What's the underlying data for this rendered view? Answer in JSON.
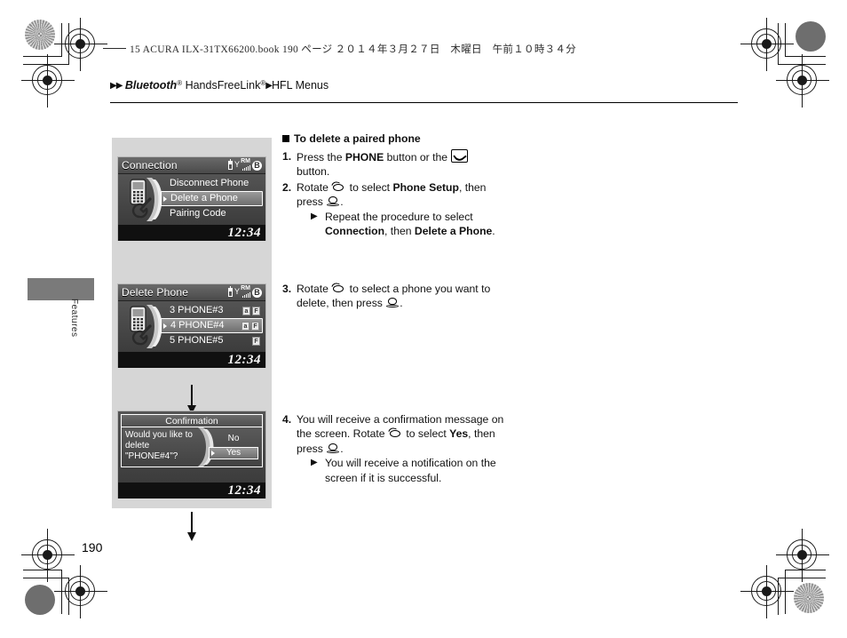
{
  "print_header": "15 ACURA ILX-31TX66200.book   190 ページ   ２０１４年３月２７日　木曜日　午前１０時３４分",
  "breadcrumb": {
    "arrow1": "▶▶",
    "bluetooth": "Bluetooth",
    "reg1": "®",
    "handsfree": " HandsFreeLink",
    "reg2": "®",
    "arrow2": "▶",
    "last": "HFL Menus"
  },
  "side_tab": {
    "label": "Features"
  },
  "page_number": "190",
  "screens": [
    {
      "title": "Connection",
      "clock": "12:34",
      "status": {
        "roaming": "RM",
        "bluetooth": "B"
      },
      "items": [
        {
          "label": "Disconnect Phone",
          "selected": false,
          "icons": []
        },
        {
          "label": "Delete a Phone",
          "selected": true,
          "icons": []
        },
        {
          "label": "Pairing Code",
          "selected": false,
          "icons": []
        }
      ]
    },
    {
      "title": "Delete Phone",
      "clock": "12:34",
      "status": {
        "roaming": "RM",
        "bluetooth": "B"
      },
      "items": [
        {
          "label": "3 PHONE#3",
          "selected": false,
          "icons": [
            "a",
            "F"
          ]
        },
        {
          "label": "4 PHONE#4",
          "selected": true,
          "icons": [
            "a",
            "F"
          ]
        },
        {
          "label": "5 PHONE#5",
          "selected": false,
          "icons": [
            "F"
          ]
        }
      ]
    },
    {
      "title": "Confirmation",
      "clock": "12:34",
      "message": "Would you like to\ndelete\n\"PHONE#4\"?",
      "buttons": [
        {
          "label": "No",
          "selected": false
        },
        {
          "label": "Yes",
          "selected": true
        }
      ]
    }
  ],
  "instructions": {
    "heading": "To delete a paired phone",
    "step1": {
      "num": "1.",
      "a": "Press the ",
      "bold1": "PHONE",
      "b": " button or the ",
      "c": " button."
    },
    "step2": {
      "num": "2.",
      "a": "Rotate ",
      "b": " to select ",
      "bold1": "Phone Setup",
      "c": ", then press ",
      "d": ".",
      "sub_a": "Repeat the procedure to select ",
      "sub_bold1": "Connection",
      "sub_b": ", then ",
      "sub_bold2": "Delete a Phone",
      "sub_c": "."
    },
    "step3": {
      "num": "3.",
      "a": "Rotate ",
      "b": " to select a phone you want to delete, then press ",
      "c": "."
    },
    "step4": {
      "num": "4.",
      "a": "You will receive a confirmation message on the screen. Rotate ",
      "b": " to select ",
      "bold1": "Yes",
      "c": ", then press ",
      "d": ".",
      "sub_a": "You will receive a notification on the screen if it is successful."
    },
    "triangle": "▶"
  }
}
